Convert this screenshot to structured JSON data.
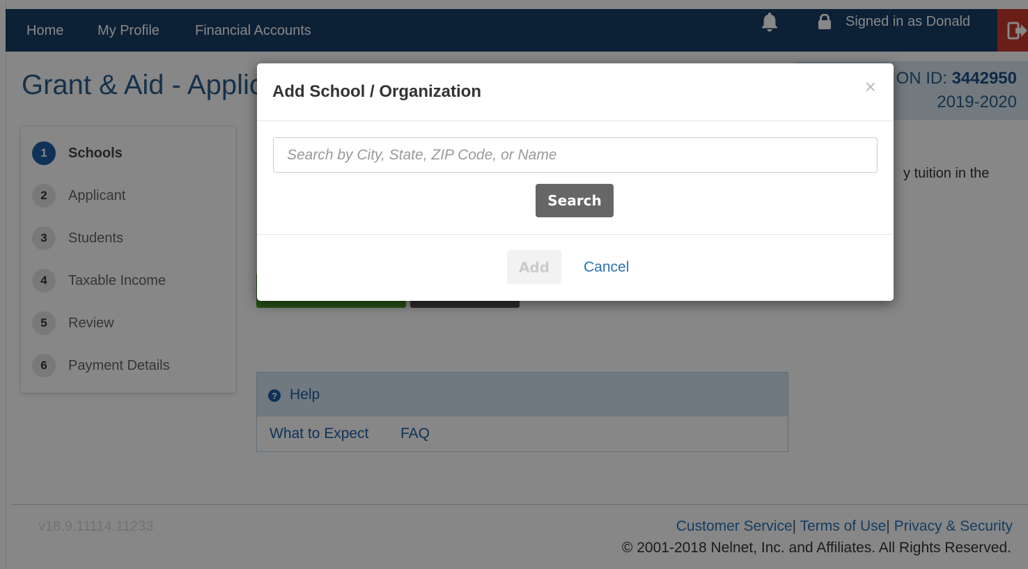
{
  "nav": {
    "home": "Home",
    "profile": "My Profile",
    "accounts": "Financial Accounts",
    "signed_in": "Signed in as Donald"
  },
  "header": {
    "title": "Grant & Aid - Applic",
    "app_id_label": "ON ID:",
    "app_id_value": "3442950",
    "year": "2019-2020"
  },
  "steps": [
    {
      "num": "1",
      "label": "Schools"
    },
    {
      "num": "2",
      "label": "Applicant"
    },
    {
      "num": "3",
      "label": "Students"
    },
    {
      "num": "4",
      "label": "Taxable Income"
    },
    {
      "num": "5",
      "label": "Review"
    },
    {
      "num": "6",
      "label": "Payment Details"
    }
  ],
  "content": {
    "partial_text": "y tuition in the"
  },
  "help": {
    "icon": "?",
    "title": "Help",
    "links": [
      "What to Expect",
      "FAQ"
    ]
  },
  "footer": {
    "version": "v18.9.11114.11233",
    "links": [
      "Customer Service",
      "Terms of Use",
      "Privacy & Security"
    ],
    "separator": "|",
    "copyright": "© 2001-2018 Nelnet, Inc. and Affiliates. All Rights Reserved."
  },
  "modal": {
    "title": "Add School / Organization",
    "close": "×",
    "search_placeholder": "Search by City, State, ZIP Code, or Name",
    "search_button": "Search",
    "add_button": "Add",
    "cancel": "Cancel"
  },
  "colors": {
    "nav_bg": "#173e66",
    "primary": "#1f5fa5",
    "logout": "#c93a2c",
    "link": "#2a73b5"
  }
}
